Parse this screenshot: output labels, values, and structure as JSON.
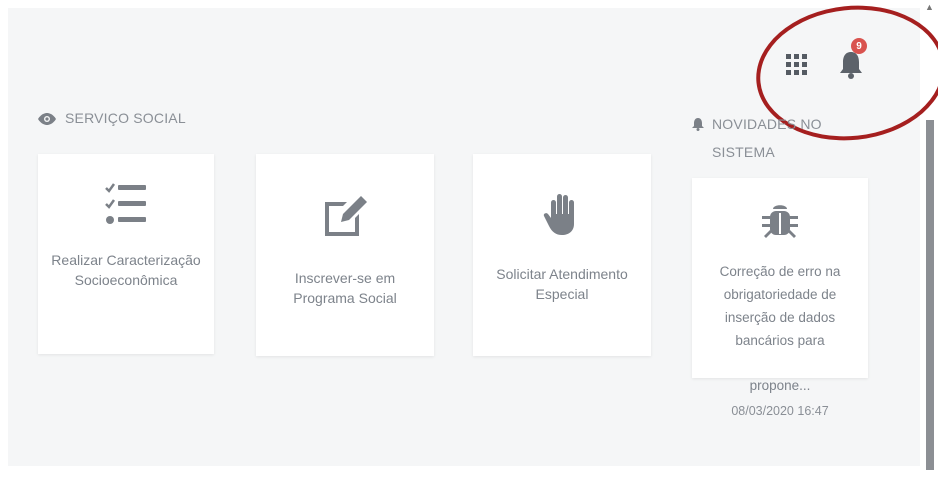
{
  "header": {
    "apps_icon": "grid-icon",
    "notifications_icon": "bell-icon",
    "notifications_badge": "9"
  },
  "services": {
    "title": "SERVIÇO SOCIAL",
    "icon": "eye-icon",
    "cards": [
      {
        "label": "Realizar Caracterização Socioeconômica",
        "icon": "checklist-icon"
      },
      {
        "label": "Inscrever-se em Programa Social",
        "icon": "edit-icon"
      },
      {
        "label": "Solicitar Atendimento Especial",
        "icon": "hand-icon"
      }
    ]
  },
  "news": {
    "title": "NOVIDADES NO SISTEMA",
    "icon": "bell-icon",
    "items": [
      {
        "icon": "bug-icon",
        "text": "Correção de erro na obrigatoriedade de inserção de dados bancários para",
        "text_overflow": "propone...",
        "date": "08/03/2020 16:47"
      }
    ]
  },
  "colors": {
    "annotation_circle": "#a51f1f",
    "badge": "#d9534f",
    "icon_gray": "#7b8087"
  }
}
